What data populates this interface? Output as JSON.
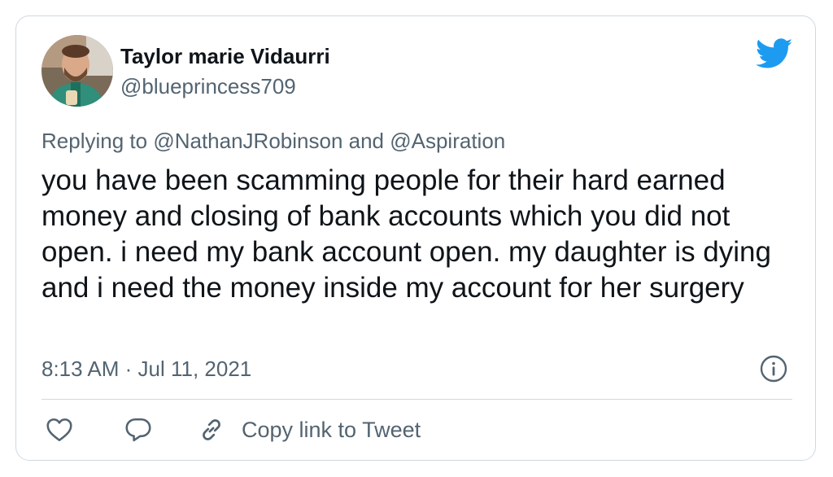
{
  "author": {
    "name": "Taylor marie Vidaurri",
    "handle": "@blueprincess709",
    "avatar_icon": "avatar-photo"
  },
  "reply": {
    "prefix": "Replying to ",
    "mention1": "@NathanJRobinson",
    "and": " and ",
    "mention2": "@Aspiration"
  },
  "tweet": {
    "text": "you have been scamming people for their hard earned money and closing of bank accounts which you did not open. i need my bank account open. my daughter is dying and i need the money inside my account for her surgery",
    "timestamp": "8:13 AM · Jul 11, 2021"
  },
  "actions": {
    "copy_link_label": "Copy link to Tweet"
  },
  "icons": {
    "brand": "twitter-bird-icon",
    "info": "info-icon",
    "like": "heart-icon",
    "reply": "speech-bubble-icon",
    "link": "link-icon"
  },
  "colors": {
    "brand": "#1d9bf0",
    "primary_text": "#0f1419",
    "secondary_text": "#536471",
    "border": "#cfd9de",
    "like_icon": "#536471"
  }
}
